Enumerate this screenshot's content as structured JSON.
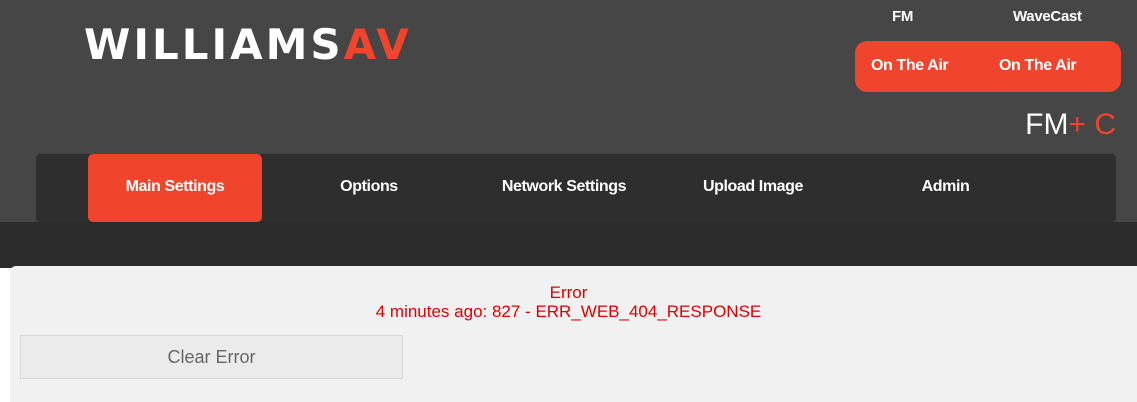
{
  "brand": {
    "logo_main": "WILLIAMS",
    "logo_accent": "AV"
  },
  "status": {
    "fm_label": "FM",
    "wavecast_label": "WaveCast",
    "fm_state": "On The Air",
    "wavecast_state": "On The Air"
  },
  "model": {
    "name": "FM",
    "suffix": "+ C"
  },
  "nav": {
    "items": [
      {
        "label": "Main Settings",
        "active": true
      },
      {
        "label": "Options",
        "active": false
      },
      {
        "label": "Network Settings",
        "active": false
      },
      {
        "label": "Upload Image",
        "active": false
      },
      {
        "label": "Admin",
        "active": false
      }
    ]
  },
  "error": {
    "title": "Error",
    "message": "4 minutes ago: 827 - ERR_WEB_404_RESPONSE",
    "clear_label": "Clear Error"
  },
  "colors": {
    "accent": "#f0442c",
    "header_bg": "#464646",
    "nav_bg": "#2e2e2e",
    "error_text": "#e00000"
  }
}
